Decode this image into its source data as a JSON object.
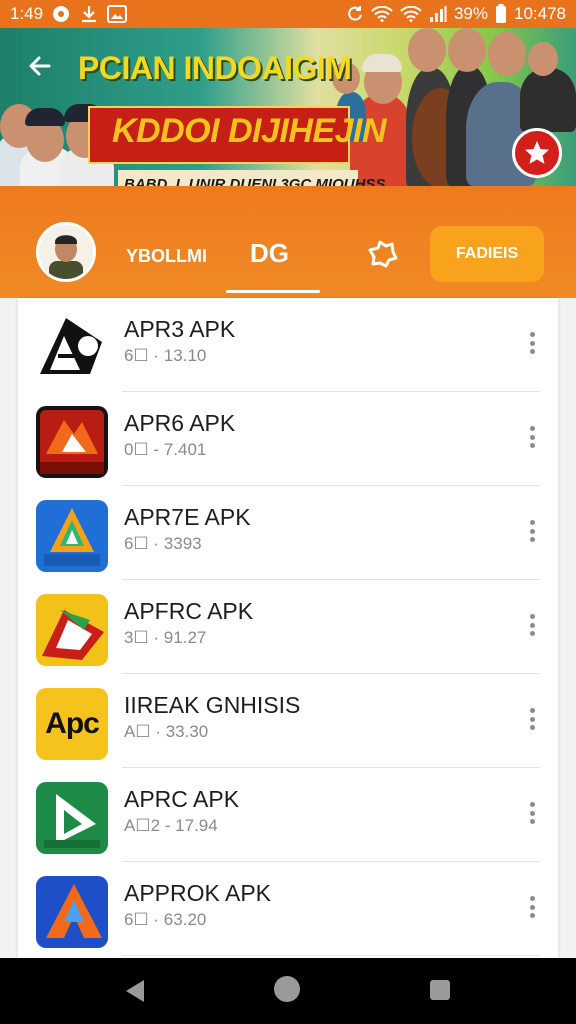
{
  "status_bar": {
    "time": "1:49",
    "battery": "39%",
    "clock_right": "10:478"
  },
  "banner": {
    "title_line1": "PCIAN INDOAIGIM",
    "title_line2": "KDDOI DIJIHEJIN",
    "subtitle": "BABD. L UNIR DUENI 3GC MIOUHSS",
    "back_icon": "arrow-left-icon",
    "badge_icon": "star-badge-icon"
  },
  "tabs": {
    "tab1": "YBOLLMI",
    "tab2": "DG",
    "tab3_icon": "home-puzzle-icon",
    "tab4": "FADIEIS"
  },
  "apps": [
    {
      "name": "APR3 APK",
      "meta": "6 •  1310",
      "meta_prefix": "6☐",
      "meta_value": " · 13.10",
      "icon": "apr3-logo-icon"
    },
    {
      "name": "APR6 APK",
      "meta_prefix": "0☐",
      "meta_value": " - 7.401",
      "icon": "apr6-logo-icon"
    },
    {
      "name": "APR7E APK",
      "meta_prefix": "6☐",
      "meta_value": " · 3393",
      "icon": "apr7e-logo-icon"
    },
    {
      "name": "APFRC APK",
      "meta_prefix": "3☐",
      "meta_value": " · 91.27",
      "icon": "apfrc-logo-icon"
    },
    {
      "name": "IIREAK GNHISIS",
      "meta_prefix": "A☐",
      "meta_value": " · 33.30",
      "icon": "apc-logo-icon"
    },
    {
      "name": "APRC APK",
      "meta_prefix": "A☐2",
      "meta_value": " - 17.94",
      "icon": "aprc-logo-icon"
    },
    {
      "name": "APPROK APK",
      "meta_prefix": "6☐",
      "meta_value": " · 63.20",
      "icon": "approk-logo-icon"
    }
  ],
  "apc_icon_text": "Apc",
  "colors": {
    "accent": "#ee7a1e",
    "tab_active_bg": "#f9a21c",
    "ribbon_red": "#c61f16",
    "title_yellow": "#f4d91e"
  }
}
